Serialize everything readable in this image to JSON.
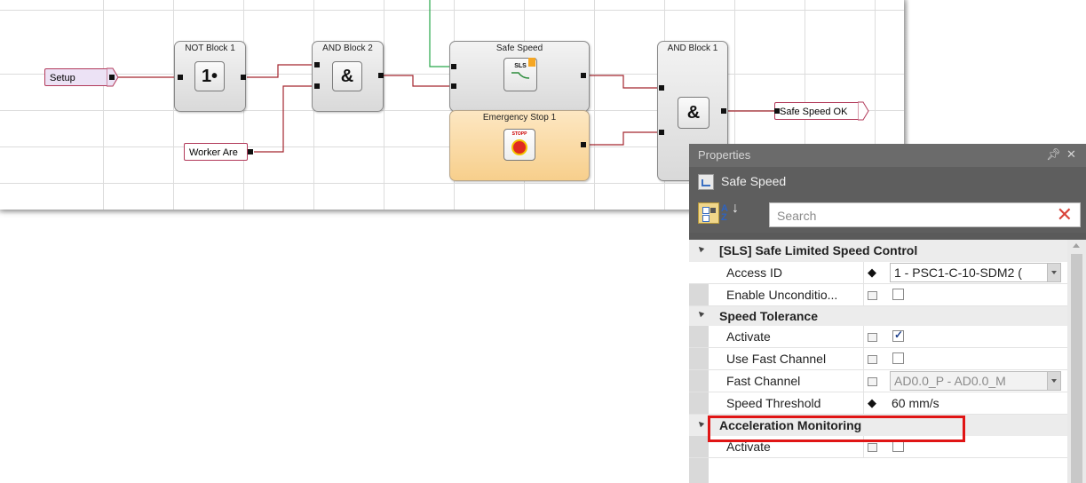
{
  "diagram": {
    "blocks": {
      "not_block": {
        "title": "NOT Block 1",
        "symbol": "1•"
      },
      "and_block_2": {
        "title": "AND Block 2",
        "symbol": "&"
      },
      "safe_speed": {
        "title": "Safe Speed",
        "icon_text": "SLS"
      },
      "emergency_stop": {
        "title": "Emergency Stop 1",
        "icon_text": "STOPP"
      },
      "and_block_1": {
        "title": "AND Block 1",
        "symbol": "&"
      }
    },
    "tags": {
      "setup": "Setup",
      "worker_area": "Worker Are",
      "safe_speed_ok": "Safe Speed OK"
    },
    "colors": {
      "wire": "#a3262e",
      "wire_green": "#27a84a",
      "orange_block": "#f9d496"
    }
  },
  "properties_panel": {
    "header_title": "Properties",
    "pin_icon": "pin-icon",
    "close_icon": "close-icon",
    "object_name": "Safe Speed",
    "search": {
      "placeholder": "Search",
      "value": ""
    },
    "categories": [
      {
        "label": "[SLS] Safe Limited Speed Control"
      },
      {
        "label": "Speed Tolerance"
      },
      {
        "label": "Acceleration Monitoring"
      }
    ],
    "rows": {
      "access_id": {
        "name": "Access ID",
        "value": "1 - PSC1-C-10-SDM2 ("
      },
      "enable_uncond": {
        "name": "Enable Unconditio...",
        "checked": false
      },
      "activate_1": {
        "name": "Activate",
        "checked": true
      },
      "use_fast_channel": {
        "name": "Use Fast Channel",
        "checked": false
      },
      "fast_channel": {
        "name": "Fast Channel",
        "value": "AD0.0_P - AD0.0_M"
      },
      "speed_threshold": {
        "name": "Speed Threshold",
        "value": "60 mm/s"
      },
      "activate_2": {
        "name": "Activate",
        "checked": false
      }
    }
  }
}
